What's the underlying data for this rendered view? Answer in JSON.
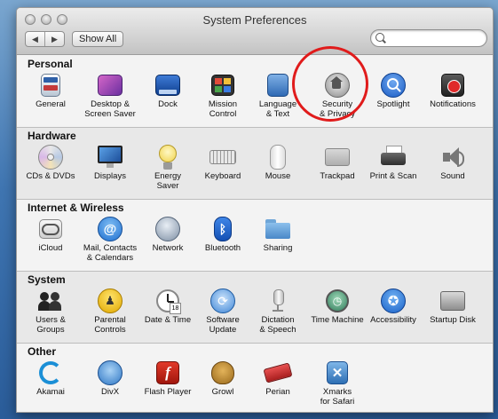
{
  "window": {
    "title": "System Preferences",
    "back_glyph": "◀",
    "forward_glyph": "▶",
    "show_all_label": "Show All",
    "search_value": ""
  },
  "sections": [
    {
      "title": "Personal",
      "items": [
        {
          "label": "General",
          "icon": "general-icon"
        },
        {
          "label": "Desktop &\nScreen Saver",
          "icon": "desktop-icon"
        },
        {
          "label": "Dock",
          "icon": "dock-icon"
        },
        {
          "label": "Mission\nControl",
          "icon": "mission-control-icon"
        },
        {
          "label": "Language\n& Text",
          "icon": "language-icon"
        },
        {
          "label": "Security\n& Privacy",
          "icon": "security-icon"
        },
        {
          "label": "Spotlight",
          "icon": "spotlight-icon"
        },
        {
          "label": "Notifications",
          "icon": "notifications-icon"
        }
      ]
    },
    {
      "title": "Hardware",
      "items": [
        {
          "label": "CDs & DVDs",
          "icon": "cd-icon"
        },
        {
          "label": "Displays",
          "icon": "displays-icon"
        },
        {
          "label": "Energy\nSaver",
          "icon": "energy-icon"
        },
        {
          "label": "Keyboard",
          "icon": "keyboard-icon"
        },
        {
          "label": "Mouse",
          "icon": "mouse-icon"
        },
        {
          "label": "Trackpad",
          "icon": "trackpad-icon"
        },
        {
          "label": "Print & Scan",
          "icon": "printer-icon"
        },
        {
          "label": "Sound",
          "icon": "sound-icon"
        }
      ]
    },
    {
      "title": "Internet & Wireless",
      "items": [
        {
          "label": "iCloud",
          "icon": "icloud-icon"
        },
        {
          "label": "Mail, Contacts\n& Calendars",
          "icon": "mail-icon"
        },
        {
          "label": "Network",
          "icon": "network-icon"
        },
        {
          "label": "Bluetooth",
          "icon": "bluetooth-icon"
        },
        {
          "label": "Sharing",
          "icon": "sharing-icon"
        }
      ]
    },
    {
      "title": "System",
      "items": [
        {
          "label": "Users &\nGroups",
          "icon": "users-icon"
        },
        {
          "label": "Parental\nControls",
          "icon": "parental-icon"
        },
        {
          "label": "Date & Time",
          "icon": "clock-icon"
        },
        {
          "label": "Software\nUpdate",
          "icon": "update-icon"
        },
        {
          "label": "Dictation\n& Speech",
          "icon": "microphone-icon"
        },
        {
          "label": "Time Machine",
          "icon": "time-machine-icon"
        },
        {
          "label": "Accessibility",
          "icon": "accessibility-icon"
        },
        {
          "label": "Startup Disk",
          "icon": "disk-icon"
        }
      ]
    },
    {
      "title": "Other",
      "items": [
        {
          "label": "Akamai",
          "icon": "akamai-icon"
        },
        {
          "label": "DivX",
          "icon": "divx-icon"
        },
        {
          "label": "Flash Player",
          "icon": "flash-icon"
        },
        {
          "label": "Growl",
          "icon": "growl-icon"
        },
        {
          "label": "Perian",
          "icon": "perian-icon"
        },
        {
          "label": "Xmarks\nfor Safari",
          "icon": "xmarks-icon"
        }
      ]
    }
  ],
  "annotation": {
    "color": "#e01b1b"
  }
}
